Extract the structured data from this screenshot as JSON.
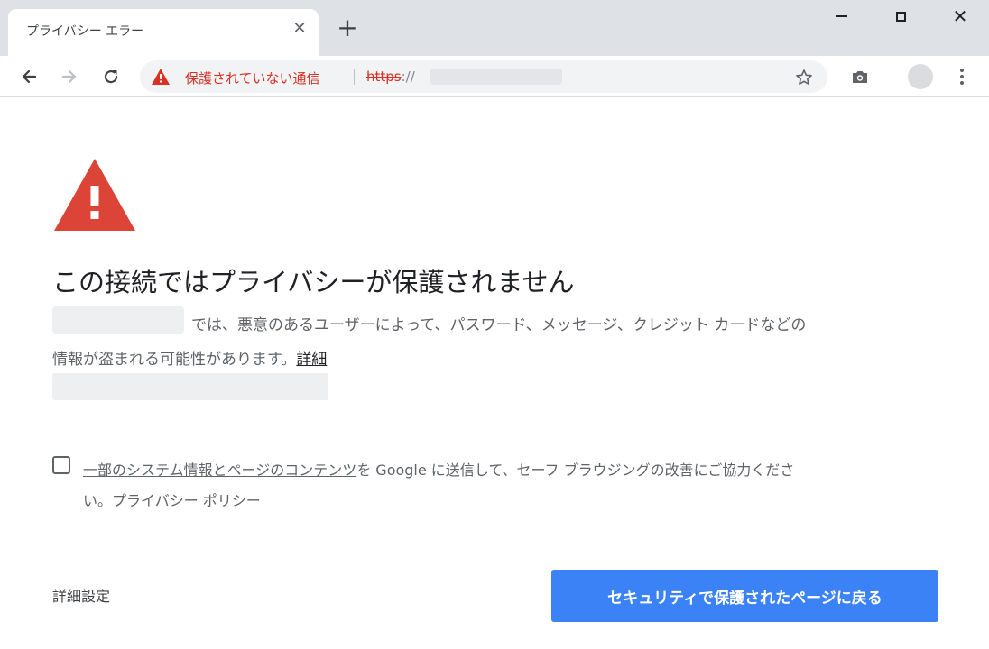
{
  "browser": {
    "tab_title": "プライバシー エラー",
    "tab_close_glyph": "✕",
    "new_tab_glyph": "+",
    "win_close_glyph": "✕"
  },
  "toolbar": {
    "insecure_label": "保護されていない通信",
    "url_scheme": "https",
    "url_separator": "://"
  },
  "page": {
    "heading": "この接続ではプライバシーが保護されません",
    "description_line1": "では、悪意のあるユーザーによって、パスワード、メッセージ、クレジット カードなどの",
    "description_line2": "情報が盗まれる可能性があります。",
    "details_link": "詳細",
    "optin_link": "一部のシステム情報とページのコンテンツ",
    "optin_text_line1": "を Google に送信して、セーフ ブラウジングの改善にご協力くださ",
    "optin_text_line2": "い。",
    "privacy_link": "プライバシー ポリシー",
    "advanced_button": "詳細設定",
    "back_button": "セキュリティで保護されたページに戻る"
  },
  "icons": {
    "back": "arrow-left-icon",
    "forward": "arrow-right-icon",
    "reload": "reload-icon",
    "warning": "warning-triangle-icon",
    "bookmark": "star-icon",
    "camera": "camera-icon",
    "menu": "more-vert-icon"
  },
  "colors": {
    "danger_red": "#d93025",
    "warning_triangle": "#db4437",
    "primary_button": "#3b82f6",
    "tab_bar": "#dee1e6"
  }
}
